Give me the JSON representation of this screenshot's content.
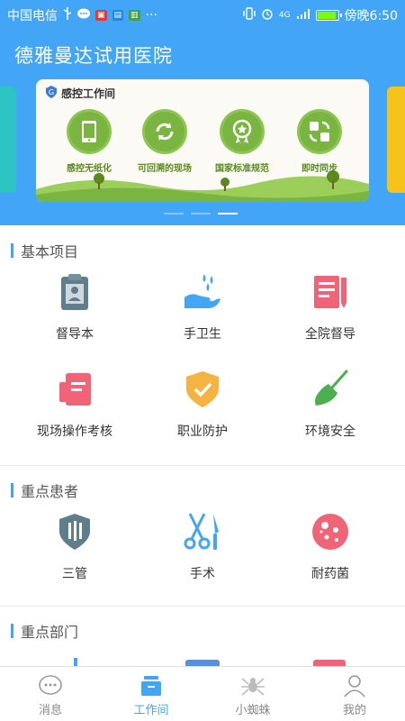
{
  "status_bar": {
    "carrier": "中国电信",
    "time": "傍晚6:50",
    "network": "4G",
    "left_icons": [
      "usb-icon",
      "chat-icon",
      "app-icon",
      "pay-icon",
      "message-icon",
      "more-icon"
    ],
    "right_icons": [
      "vibrate-icon",
      "alarm-icon",
      "signal-icon",
      "battery-icon"
    ]
  },
  "header": {
    "title": "德雅曼达试用医院",
    "background_color": "#42a5f5"
  },
  "banner": {
    "logo_text": "感控工作间",
    "features": [
      {
        "label": "感控无纸化",
        "icon": "phone-icon"
      },
      {
        "label": "可回溯的现场",
        "icon": "refresh-icon"
      },
      {
        "label": "国家标准规范",
        "icon": "medal-icon"
      },
      {
        "label": "即时同步",
        "icon": "sync-icon"
      }
    ],
    "active_page": 3,
    "page_count": 3
  },
  "sections": {
    "basic": {
      "title": "基本项目",
      "items": [
        {
          "label": "督导本",
          "icon": "clipboard-user-icon",
          "color": "#607d8b"
        },
        {
          "label": "手卫生",
          "icon": "hand-water-icon",
          "color": "#42a5f5"
        },
        {
          "label": "全院督导",
          "icon": "document-pen-icon",
          "color": "#f06478"
        },
        {
          "label": "现场操作考核",
          "icon": "notebook-icon",
          "color": "#f06478"
        },
        {
          "label": "职业防护",
          "icon": "shield-check-icon",
          "color": "#f5b342"
        },
        {
          "label": "环境安全",
          "icon": "broom-icon",
          "color": "#4caf50"
        }
      ]
    },
    "patients": {
      "title": "重点患者",
      "items": [
        {
          "label": "三管",
          "icon": "tubes-shield-icon",
          "color": "#607d8b"
        },
        {
          "label": "手术",
          "icon": "scissors-scalpel-icon",
          "color": "#42a5f5"
        },
        {
          "label": "耐药菌",
          "icon": "bacteria-icon",
          "color": "#f06478"
        }
      ]
    },
    "departments": {
      "title": "重点部门"
    }
  },
  "bottom_nav": {
    "items": [
      {
        "label": "消息",
        "icon": "chat-bubble-icon"
      },
      {
        "label": "工作间",
        "icon": "workspace-icon"
      },
      {
        "label": "小蜘蛛",
        "icon": "spider-icon"
      },
      {
        "label": "我的",
        "icon": "user-icon"
      }
    ],
    "active_index": 1,
    "active_color": "#42a5f5"
  }
}
